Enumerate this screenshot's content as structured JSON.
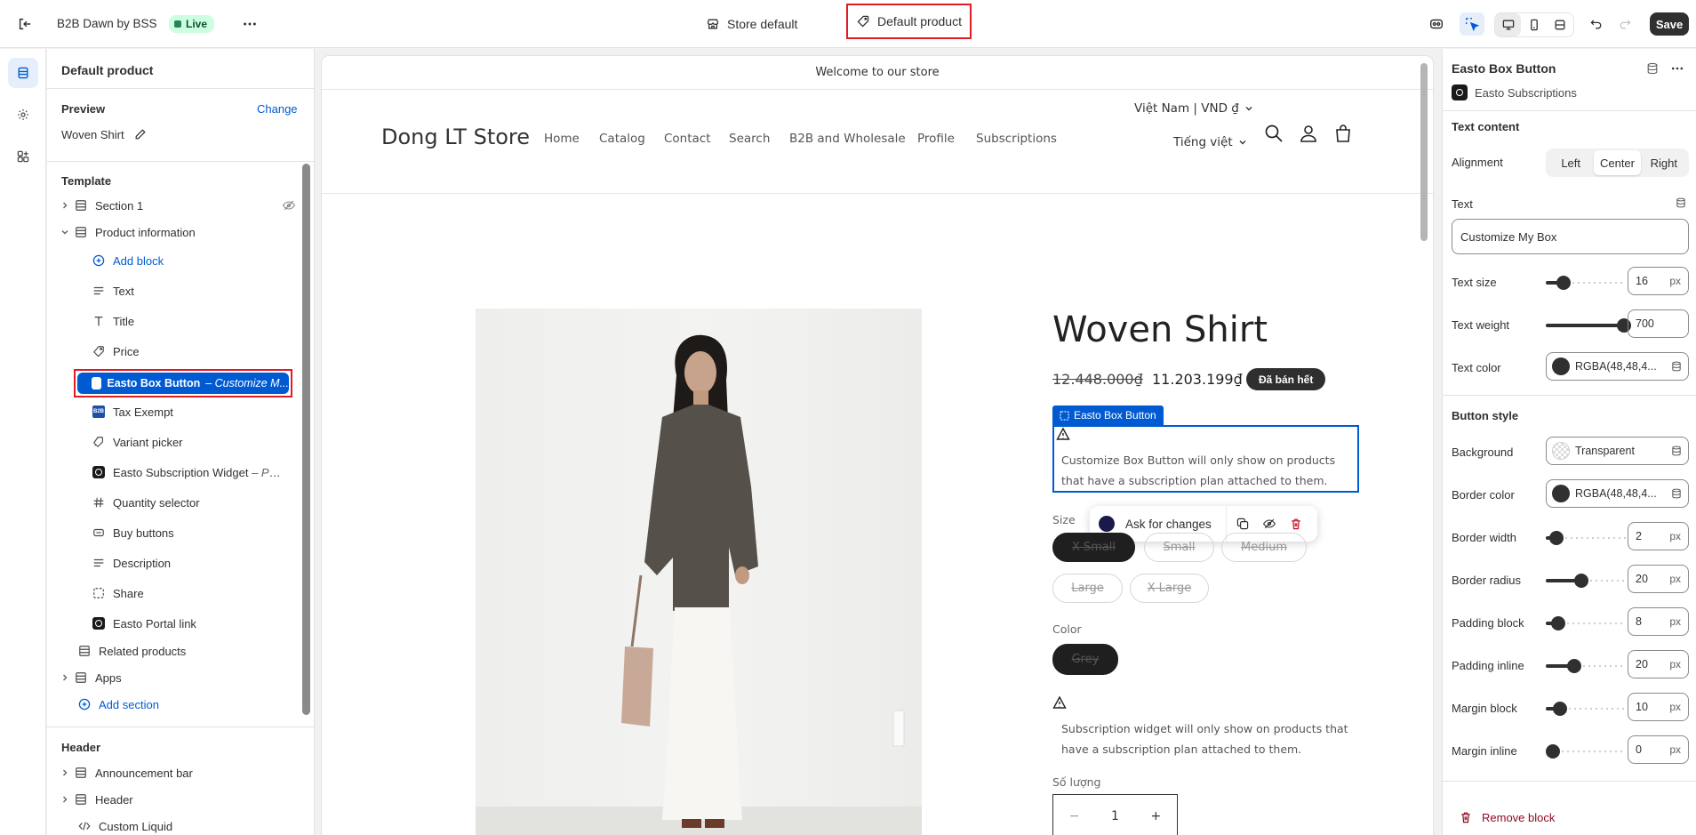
{
  "topbar": {
    "app_name": "B2B Dawn by BSS",
    "live_label": "Live",
    "store_selector": "Store default",
    "template_selector": "Default product",
    "save_label": "Save"
  },
  "left_panel": {
    "title": "Default product",
    "preview_label": "Preview",
    "change_label": "Change",
    "preview_value": "Woven Shirt",
    "template_heading": "Template",
    "section1": "Section 1",
    "product_info": "Product information",
    "add_block": "Add block",
    "blocks": {
      "text": "Text",
      "title": "Title",
      "price": "Price",
      "easto_box": "Easto Box Button",
      "easto_box_suffix": "– Customize M...",
      "tax_exempt": "Tax Exempt",
      "variant_picker": "Variant picker",
      "easto_widget": "Easto Subscription Widget",
      "easto_widget_suffix": "– Pur...",
      "quantity_selector": "Quantity selector",
      "buy_buttons": "Buy buttons",
      "description": "Description",
      "share": "Share",
      "easto_portal": "Easto Portal link"
    },
    "related_products": "Related products",
    "apps": "Apps",
    "add_section": "Add section",
    "header_heading": "Header",
    "announcement_bar": "Announcement bar",
    "header": "Header",
    "custom_liquid": "Custom Liquid"
  },
  "store": {
    "announcement": "Welcome to our store",
    "name": "Dong LT Store",
    "nav": [
      "Home",
      "Catalog",
      "Contact",
      "Search",
      "B2B and Wholesale",
      "Profile",
      "Subscriptions"
    ],
    "currency": "Việt Nam | VND ₫",
    "language": "Tiếng việt",
    "product_title": "Woven Shirt",
    "price_old": "12.448.000₫",
    "price_new": "11.203.199₫",
    "sold_out": "Đã bán hết",
    "block_tag": "Easto Box Button",
    "box_notice": "Customize Box Button will only show on products that have a subscription plan attached to them.",
    "ask_label": "Ask for changes",
    "size_label": "Size",
    "sizes": [
      "X-Small",
      "Small",
      "Medium",
      "Large",
      "X-Large"
    ],
    "color_label": "Color",
    "colors": [
      "Grey"
    ],
    "widget_notice": "Subscription widget will only show on products that have a subscription plan attached to them.",
    "qty_label": "Số lượng",
    "qty_value": "1",
    "qty_minus": "−",
    "qty_plus": "+"
  },
  "right_panel": {
    "block_title": "Easto Box Button",
    "app_name": "Easto Subscriptions",
    "text_content_heading": "Text content",
    "alignment_label": "Alignment",
    "alignment_options": [
      "Left",
      "Center",
      "Right"
    ],
    "alignment_selected": "Center",
    "text_label": "Text",
    "text_value": "Customize My Box",
    "text_size_label": "Text size",
    "text_size": "16",
    "text_weight_label": "Text weight",
    "text_weight": "700",
    "text_color_label": "Text color",
    "text_color": "RGBA(48,48,4...",
    "button_style_heading": "Button style",
    "background_label": "Background",
    "background_value": "Transparent",
    "border_color_label": "Border color",
    "border_color": "RGBA(48,48,4...",
    "border_width_label": "Border width",
    "border_width": "2",
    "border_radius_label": "Border radius",
    "border_radius": "20",
    "padding_block_label": "Padding block",
    "padding_block": "8",
    "padding_inline_label": "Padding inline",
    "padding_inline": "20",
    "margin_block_label": "Margin block",
    "margin_block": "10",
    "margin_inline_label": "Margin inline",
    "margin_inline": "0",
    "unit": "px",
    "remove_block": "Remove block"
  },
  "colors": {
    "accent": "#005bd3",
    "highlight": "#e11d24",
    "dark": "#303030"
  }
}
